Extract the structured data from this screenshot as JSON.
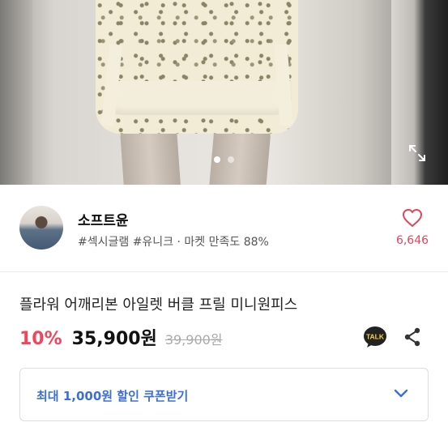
{
  "gallery": {
    "dot_count": 2,
    "active_index": 0
  },
  "seller": {
    "name": "소프트윤",
    "tags": "#섹시글램 #유니크 · 마켓 만족도 88%",
    "like_count": "6,646"
  },
  "product": {
    "title": "플라워 어깨리본 아일렛 버클 프릴 미니원피스",
    "discount": "10%",
    "price": "35,900원",
    "original_price": "39,900원",
    "talk_label": "TALK"
  },
  "coupon": {
    "label": "최대 1,000원 할인 쿠폰받기"
  },
  "colors": {
    "accent_red": "#f2455b",
    "coupon_blue": "#3b6fd6",
    "like_pink": "#e0455b"
  },
  "icons": [
    "expand-icon",
    "heart-icon",
    "kakaotalk-icon",
    "share-icon",
    "chevron-down-icon"
  ]
}
